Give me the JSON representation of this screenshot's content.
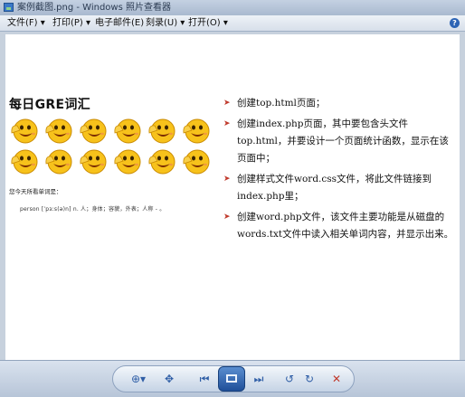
{
  "window": {
    "title": "案例截图.png - Windows 照片查看器"
  },
  "menu": [
    {
      "label": "文件(F) ▾"
    },
    {
      "label": "打印(P) ▾"
    },
    {
      "label": "电子邮件(E)"
    },
    {
      "label": "刻录(U) ▾"
    },
    {
      "label": "打开(O) ▾"
    }
  ],
  "help": {
    "label": "?"
  },
  "content": {
    "heading": "每日GRE词汇",
    "prompt": "您今天所看单词是：",
    "definition": "person [ˈpɜːs(ə)n] n. 人；身体；容貌，外表；人称 - 。",
    "bullets": [
      "创建top.html页面；",
      "创建index.php页面，其中要包含头文件top.html，并要设计一个页面统计函数，显示在该页面中；",
      "创建样式文件word.css文件，将此文件链接到index.php里；",
      "创建word.php文件，该文件主要功能是从磁盘的words.txt文件中读入相关单词内容，并显示出来。"
    ],
    "emoji_icon": "smiley-face-icon",
    "emoji_rows": 2,
    "emoji_cols": 6
  },
  "toolbar": {
    "zoom": "⊕▾",
    "fit": "✥",
    "prev": "⏮",
    "next": "⏭",
    "rotate_ccw": "↺",
    "rotate_cw": "↻",
    "delete": "✕"
  },
  "colors": {
    "accent_red": "#c0392b",
    "title_blue": "#2b3b52"
  }
}
